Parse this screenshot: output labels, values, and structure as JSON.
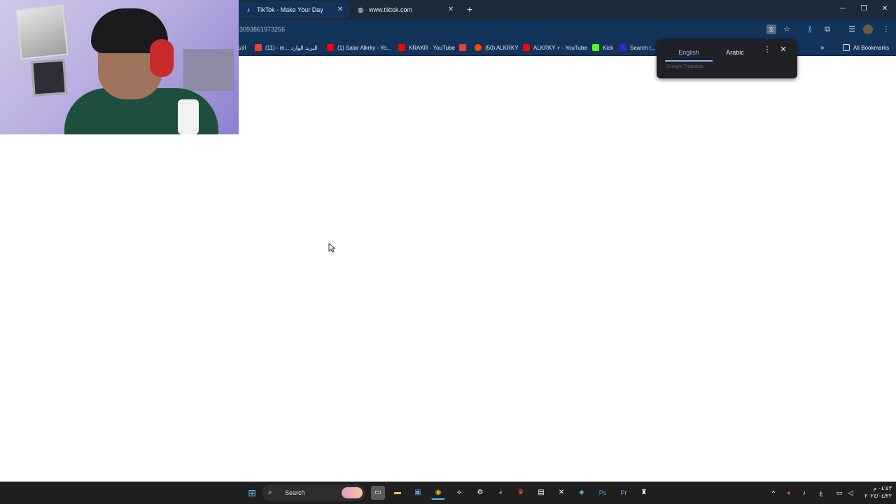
{
  "tabs": [
    {
      "title": "TikTok - Make Your Day",
      "favicon": "tiktok-icon"
    },
    {
      "title": "www.tiktok.com",
      "favicon": "globe-icon"
    }
  ],
  "omnibox": {
    "url": "3093861973256"
  },
  "bookmarks": [
    {
      "label": "الانا",
      "color": "#3a6ea5"
    },
    {
      "label": "(11) - m... البريد الوارد",
      "color": "#ea4335"
    },
    {
      "label": "(1) Salar Alkrky - Yo...",
      "color": "#ff0000"
    },
    {
      "label": "KRAKR - YouTube",
      "color": "#ff0000"
    },
    {
      "label": "",
      "color": "#ea4335"
    },
    {
      "label": "(50) ALKRKY",
      "color": "#ff4500"
    },
    {
      "label": "ALKRKY + - YouTube",
      "color": "#ff0000"
    },
    {
      "label": "Kick",
      "color": "#53fc18"
    },
    {
      "label": "Search r...",
      "color": "#3b22c5"
    }
  ],
  "all_bookmarks": "All Bookmarks",
  "translate": {
    "source": "English",
    "target": "Arabic",
    "brand": "Google Translate"
  },
  "taskbar": {
    "search_label": "Search",
    "keyboard_lang": "ع",
    "clock_time": "٠٤:٤٣ م",
    "clock_date": "٢٠٢٤/٠٤/٢٢"
  },
  "colors": {
    "tabstrip": "#1e2a3a",
    "toolbar": "#12335a",
    "translate_accent": "#8ab4f8",
    "taskbar": "#1f1f1f"
  }
}
